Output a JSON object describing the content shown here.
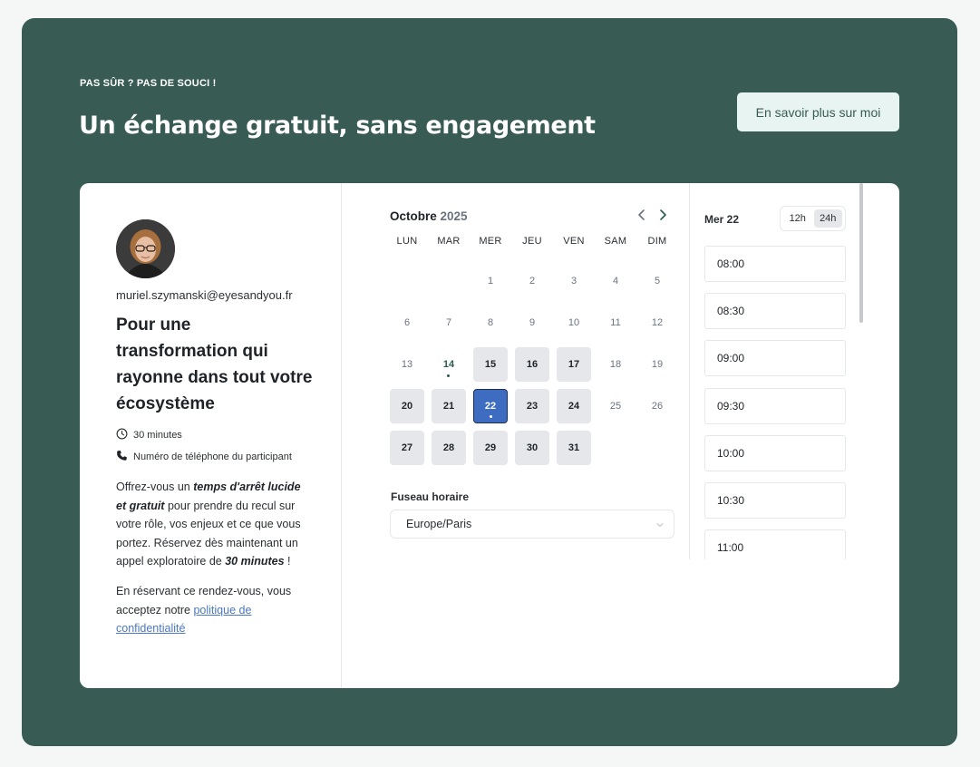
{
  "header": {
    "kicker": "PAS SÛR ? PAS DE SOUCI !",
    "title": "Un échange gratuit, sans engagement",
    "about_button": "En savoir plus sur moi"
  },
  "profile": {
    "email": "muriel.szymanski@eyesandyou.fr",
    "event_title": "Pour une transformation qui rayonne dans tout votre écosystème",
    "duration": "30 minutes",
    "location": "Numéro de téléphone du participant",
    "desc": {
      "p1": "Offrez-vous un ",
      "b1": "temps d'arrêt lucide et gratuit",
      "p2": " pour prendre du recul sur votre rôle, vos enjeux et ce que vous portez. Réservez dès maintenant un appel exploratoire de ",
      "b2": "30 minutes",
      "p3": " !"
    },
    "consent": {
      "text": "En réservant ce rendez-vous, vous acceptez notre ",
      "link": "politique de confidentialité"
    }
  },
  "calendar": {
    "month": "Octobre",
    "year": "2025",
    "weekdays": [
      "LUN",
      "MAR",
      "MER",
      "JEU",
      "VEN",
      "SAM",
      "DIM"
    ],
    "days": [
      {
        "n": "1",
        "col": 2,
        "row": 0
      },
      {
        "n": "2",
        "col": 3,
        "row": 0
      },
      {
        "n": "3",
        "col": 4,
        "row": 0
      },
      {
        "n": "4",
        "col": 5,
        "row": 0
      },
      {
        "n": "5",
        "col": 6,
        "row": 0
      },
      {
        "n": "6",
        "col": 0,
        "row": 1
      },
      {
        "n": "7",
        "col": 1,
        "row": 1
      },
      {
        "n": "8",
        "col": 2,
        "row": 1
      },
      {
        "n": "9",
        "col": 3,
        "row": 1
      },
      {
        "n": "10",
        "col": 4,
        "row": 1
      },
      {
        "n": "11",
        "col": 5,
        "row": 1
      },
      {
        "n": "12",
        "col": 6,
        "row": 1
      },
      {
        "n": "13",
        "col": 0,
        "row": 2
      },
      {
        "n": "14",
        "col": 1,
        "row": 2,
        "today": true
      },
      {
        "n": "15",
        "col": 2,
        "row": 2,
        "available": true
      },
      {
        "n": "16",
        "col": 3,
        "row": 2,
        "available": true
      },
      {
        "n": "17",
        "col": 4,
        "row": 2,
        "available": true
      },
      {
        "n": "18",
        "col": 5,
        "row": 2
      },
      {
        "n": "19",
        "col": 6,
        "row": 2
      },
      {
        "n": "20",
        "col": 0,
        "row": 3,
        "available": true
      },
      {
        "n": "21",
        "col": 1,
        "row": 3,
        "available": true
      },
      {
        "n": "22",
        "col": 2,
        "row": 3,
        "available": true,
        "selected": true
      },
      {
        "n": "23",
        "col": 3,
        "row": 3,
        "available": true
      },
      {
        "n": "24",
        "col": 4,
        "row": 3,
        "available": true
      },
      {
        "n": "25",
        "col": 5,
        "row": 3
      },
      {
        "n": "26",
        "col": 6,
        "row": 3
      },
      {
        "n": "27",
        "col": 0,
        "row": 4,
        "available": true
      },
      {
        "n": "28",
        "col": 1,
        "row": 4,
        "available": true
      },
      {
        "n": "29",
        "col": 2,
        "row": 4,
        "available": true
      },
      {
        "n": "30",
        "col": 3,
        "row": 4,
        "available": true
      },
      {
        "n": "31",
        "col": 4,
        "row": 4,
        "available": true
      }
    ],
    "timezone_label": "Fuseau horaire",
    "timezone_value": "Europe/Paris"
  },
  "slots": {
    "date": "Mer 22",
    "format_12": "12h",
    "format_24": "24h",
    "times": [
      "08:00",
      "08:30",
      "09:00",
      "09:30",
      "10:00",
      "10:30",
      "11:00"
    ]
  },
  "colors": {
    "brand_green": "#385b53",
    "selected_blue": "#3e6cc0",
    "link_blue": "#4a78c2"
  }
}
